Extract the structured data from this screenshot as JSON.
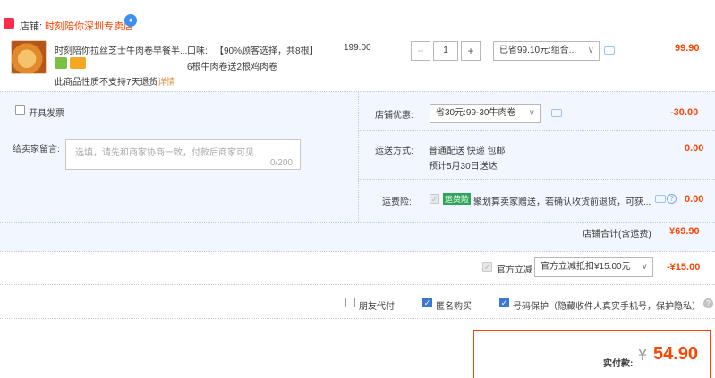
{
  "store": {
    "logo_text": "Tmall",
    "label": "店铺:",
    "name": "时刻陪你深圳专卖店",
    "badge": "♦"
  },
  "product": {
    "title": "时刻陪你拉丝芝士牛肉卷早餐半...",
    "notice": "此商品性质不支持7天退货",
    "detail_link": "详情",
    "flavor_label": "口味:",
    "flavor_value": "【90%顾客选择，共8根】",
    "flavor_line2": "6根牛肉卷送2根鸡肉卷",
    "unit_price": "199.00",
    "qty_minus": "−",
    "qty_value": "1",
    "qty_plus": "+",
    "discount_select": "已省99.10元:组合...",
    "subtotal": "99.90"
  },
  "invoice": {
    "label": "开具发票"
  },
  "message": {
    "label": "给卖家留言:",
    "placeholder": "选填，请先和商家协商一致，付款后商家可见",
    "counter": "0/200"
  },
  "store_discount": {
    "label": "店铺优惠:",
    "select": "省30元:99-30牛肉卷",
    "amount": "-30.00"
  },
  "shipping": {
    "label": "运送方式:",
    "method": "普通配送 快递 包邮",
    "eta": "预计5月30日送达",
    "amount": "0.00"
  },
  "insurance": {
    "label": "运费险:",
    "tag": "运费险",
    "desc": "聚划算卖家赠送，若确认收货前退货，可获...",
    "help": "?",
    "amount": "0.00"
  },
  "store_total": {
    "label": "店铺合计(含运费)",
    "amount": "¥69.90"
  },
  "official": {
    "label": "官方立减",
    "select": "官方立减抵扣¥15.00元",
    "amount": "-¥15.00"
  },
  "options": {
    "friend_pay": "朋友代付",
    "anonymous": "匿名购买",
    "number_protect": "号码保护（隐藏收件人真实手机号，保护隐私）",
    "help": "?"
  },
  "payment": {
    "label": "实付款:",
    "currency": "¥",
    "amount": "54.90"
  },
  "colors": {
    "accent": "#ff4400",
    "panel_bg": "#f2f7ff",
    "checkbox_blue": "#3a78d6"
  }
}
